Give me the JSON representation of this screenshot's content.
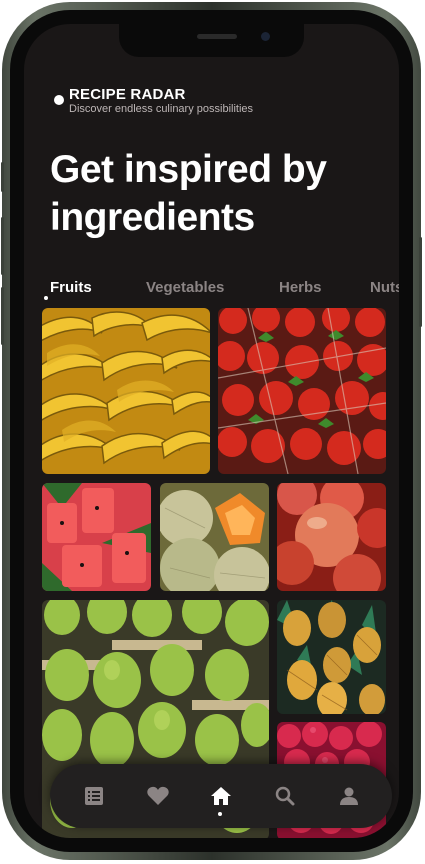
{
  "app": {
    "name": "RECIPE RADAR",
    "tagline": "Discover endless culinary possibilities"
  },
  "headline": "Get inspired by ingredients",
  "tabs": [
    {
      "label": "Fruits",
      "active": true
    },
    {
      "label": "Vegetables",
      "active": false
    },
    {
      "label": "Herbs",
      "active": false
    },
    {
      "label": "Nuts",
      "active": false
    }
  ],
  "gallery": [
    {
      "subject": "bananas"
    },
    {
      "subject": "strawberries"
    },
    {
      "subject": "watermelon"
    },
    {
      "subject": "cantaloupe"
    },
    {
      "subject": "apples"
    },
    {
      "subject": "pears"
    },
    {
      "subject": "pineapples"
    },
    {
      "subject": "raspberries"
    }
  ],
  "bottom_nav": [
    {
      "icon": "list-icon",
      "active": false
    },
    {
      "icon": "heart-icon",
      "active": false
    },
    {
      "icon": "home-icon",
      "active": true
    },
    {
      "icon": "search-icon",
      "active": false
    },
    {
      "icon": "profile-icon",
      "active": false
    }
  ],
  "colors": {
    "background": "#1a1717",
    "text_primary": "#ffffff",
    "text_muted": "#8b8484",
    "nav_bar": "#222020"
  }
}
